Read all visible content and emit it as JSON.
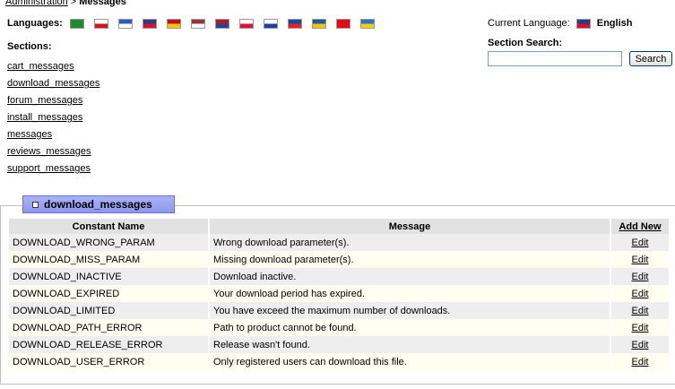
{
  "breadcrumb": {
    "parent": "Administration",
    "separator": " > ",
    "current": "Messages"
  },
  "languages": {
    "label": "Languages:",
    "flags": [
      {
        "icon": "flag-saudi-arabia-icon",
        "colors": [
          "#1f8a2c",
          "#1f8a2c"
        ]
      },
      {
        "icon": "flag-czech-icon",
        "colors": [
          "#ffffff",
          "#d7141a"
        ]
      },
      {
        "icon": "flag-greece-icon",
        "colors": [
          "#2d5fb3",
          "#ffffff"
        ]
      },
      {
        "icon": "flag-uk-icon",
        "colors": [
          "#2a3b8c",
          "#cf142b"
        ]
      },
      {
        "icon": "flag-spain-icon",
        "colors": [
          "#c60b1e",
          "#ffc400"
        ]
      },
      {
        "icon": "flag-latvia-icon",
        "colors": [
          "#9e3039",
          "#ffffff"
        ]
      },
      {
        "icon": "flag-netherlands-icon",
        "colors": [
          "#ae1c28",
          "#21468b"
        ]
      },
      {
        "icon": "flag-poland-icon",
        "colors": [
          "#ffffff",
          "#dc143c"
        ]
      },
      {
        "icon": "flag-russia-icon",
        "colors": [
          "#ffffff",
          "#1c3fa0"
        ]
      },
      {
        "icon": "flag-slovakia-icon",
        "colors": [
          "#0b4ea2",
          "#ee1c25"
        ]
      },
      {
        "icon": "flag-sweden-icon",
        "colors": [
          "#1a5aa6",
          "#f5c400"
        ]
      },
      {
        "icon": "flag-turkey-icon",
        "colors": [
          "#e30a17",
          "#e30a17"
        ]
      },
      {
        "icon": "flag-ukraine-icon",
        "colors": [
          "#2a6fd6",
          "#f5d000"
        ]
      }
    ]
  },
  "current_language": {
    "label": "Current Language:",
    "name": "English",
    "icon": "flag-uk-icon"
  },
  "sections": {
    "title": "Sections:",
    "items": [
      "cart_messages",
      "download_messages",
      "forum_messages",
      "install_messages",
      "messages",
      "reviews_messages",
      "support_messages"
    ]
  },
  "search": {
    "title": "Section Search:",
    "value": "",
    "button": "Search"
  },
  "panel": {
    "title": "download_messages"
  },
  "table": {
    "headers": {
      "constant": "Constant Name",
      "message": "Message",
      "add_new": "Add New"
    },
    "edit_label": "Edit",
    "rows": [
      {
        "constant": "DOWNLOAD_WRONG_PARAM",
        "message": "Wrong download parameter(s)."
      },
      {
        "constant": "DOWNLOAD_MISS_PARAM",
        "message": "Missing download parameter(s)."
      },
      {
        "constant": "DOWNLOAD_INACTIVE",
        "message": "Download inactive."
      },
      {
        "constant": "DOWNLOAD_EXPIRED",
        "message": "Your download period has expired."
      },
      {
        "constant": "DOWNLOAD_LIMITED",
        "message": "You have exceed the maximum number of downloads."
      },
      {
        "constant": "DOWNLOAD_PATH_ERROR",
        "message": "Path to product cannot be found."
      },
      {
        "constant": "DOWNLOAD_RELEASE_ERROR",
        "message": "Release wasn't found."
      },
      {
        "constant": "DOWNLOAD_USER_ERROR",
        "message": "Only registered users can download this file."
      }
    ]
  }
}
